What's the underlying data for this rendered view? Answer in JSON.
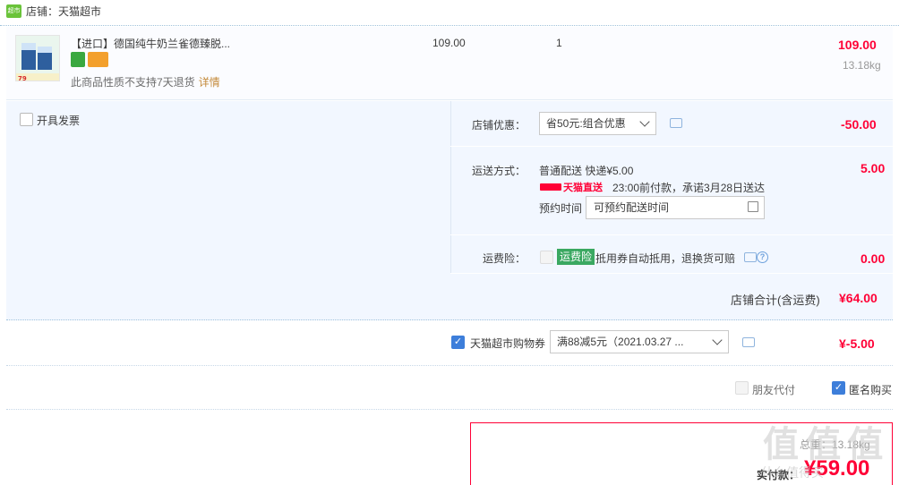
{
  "shop": {
    "logo_text": "超市",
    "name": "店铺：天猫超市"
  },
  "item": {
    "title": "【进口】德国纯牛奶兰雀德臻脱...",
    "unit_price": "109.00",
    "quantity": "1",
    "total": "109.00",
    "weight": "13.18kg",
    "return_note": "此商品性质不支持7天退货",
    "return_link": "详情",
    "thumb_price": "79"
  },
  "invoice": {
    "label": "开具发票"
  },
  "shop_discount": {
    "label": "店铺优惠：",
    "selected": "省50元:组合优惠",
    "amount": "-50.00"
  },
  "delivery": {
    "label": "运送方式：",
    "method": "普通配送 快递¥5.00",
    "amount": "5.00",
    "tmall_badge": "天猫直送",
    "promise": "23:00前付款，承诺3月28日送达",
    "schedule_label": "预约时间",
    "schedule_placeholder": "可预约配送时间"
  },
  "insurance": {
    "label": "运费险：",
    "tag": "运费险",
    "desc": "抵用券自动抵用，退换货可赔",
    "amount": "0.00"
  },
  "shop_total": {
    "label": "店铺合计(含运费)",
    "amount": "¥64.00"
  },
  "voucher": {
    "label": "天猫超市购物券",
    "selected": "满88减5元（2021.03.27 ...",
    "amount": "¥-5.00"
  },
  "options": {
    "friend_pay": "朋友代付",
    "anonymous": "匿名购买"
  },
  "pay": {
    "label": "实付款：",
    "amount": "¥59.00",
    "weight": "总重：13.18kg",
    "watermark": "值 值 值",
    "watermark_sub": "什么值得买"
  },
  "colors": {
    "accent_red": "#ff0036",
    "panel_bg": "#f2f7ff",
    "check_blue": "#3d7eda",
    "tag_green": "#3aa861"
  }
}
